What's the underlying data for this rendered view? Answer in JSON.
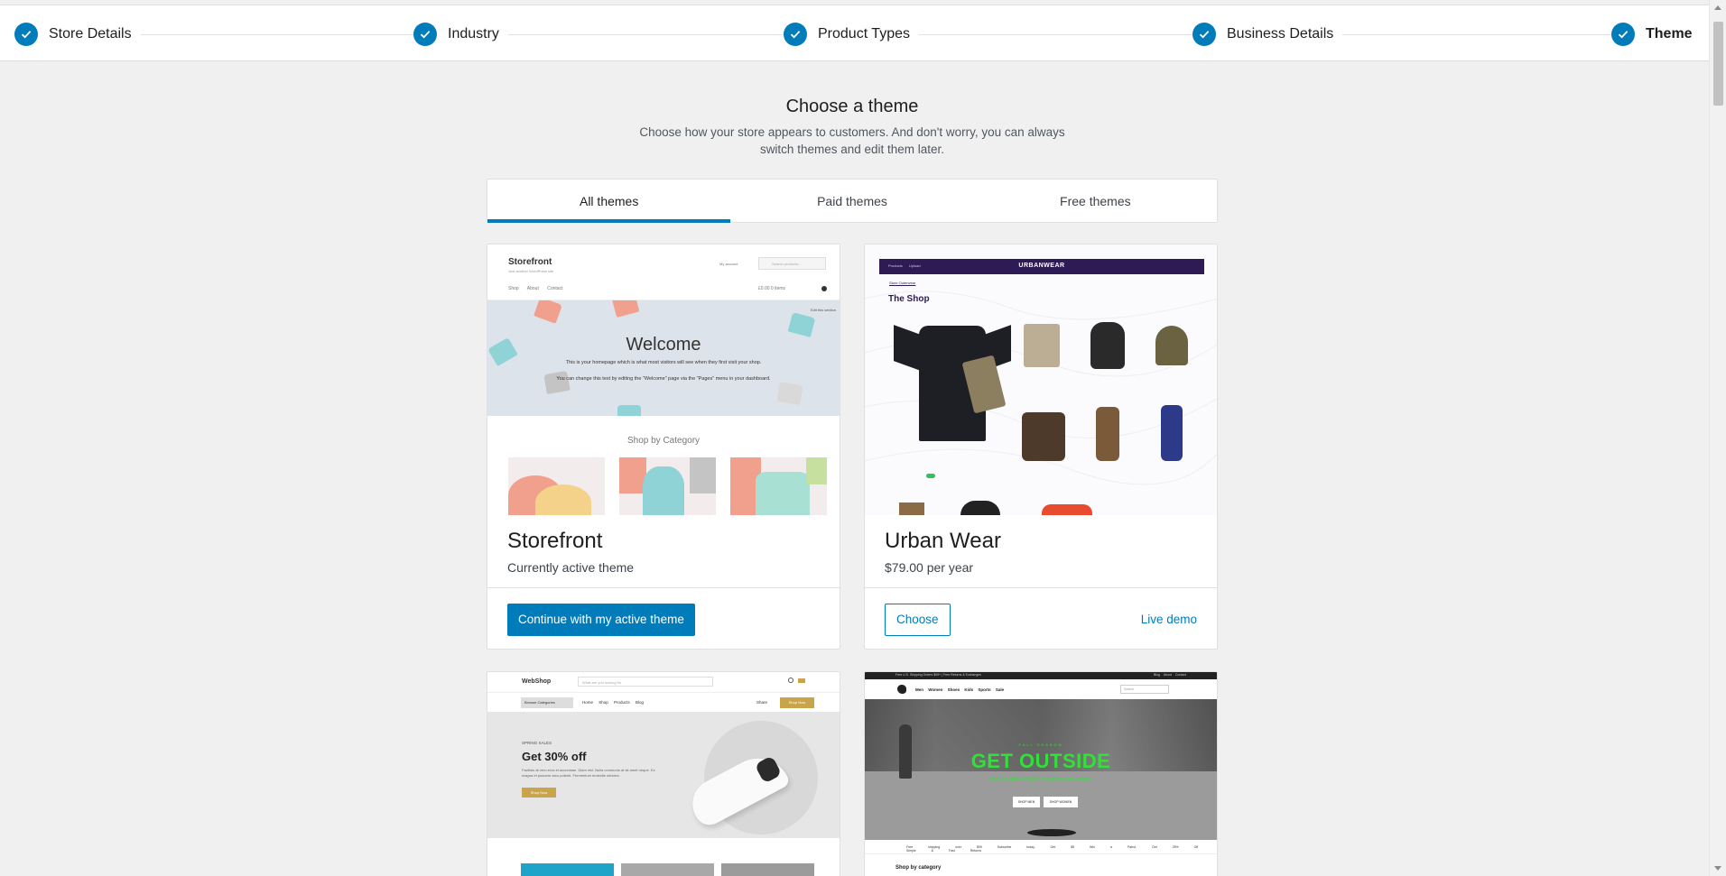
{
  "stepper": {
    "steps": [
      {
        "label": "Store Details",
        "done": true
      },
      {
        "label": "Industry",
        "done": true
      },
      {
        "label": "Product Types",
        "done": true
      },
      {
        "label": "Business Details",
        "done": true
      },
      {
        "label": "Theme",
        "done": true,
        "active": true
      }
    ]
  },
  "header": {
    "title": "Choose a theme",
    "subtitle": "Choose how your store appears to customers. And don't worry, you can always switch themes and edit them later."
  },
  "tabs": [
    {
      "label": "All themes",
      "active": true
    },
    {
      "label": "Paid themes",
      "active": false
    },
    {
      "label": "Free themes",
      "active": false
    }
  ],
  "colors": {
    "accent": "#007cba",
    "background": "#f0f0f1"
  },
  "themes": [
    {
      "name": "Storefront",
      "meta": "Currently active theme",
      "primary_action": "Continue with my active theme",
      "preview": {
        "logo": "Storefront",
        "tagline": "Just another WordPress site",
        "account": "My account",
        "search": "Search products...",
        "nav": "Shop About Contact",
        "cart": "£0.00  0 items",
        "welcome": "Welcome",
        "banner_line1": "This is your homepage which is what most visitors will see when they first visit your shop.",
        "banner_line2": "You can change this text by editing the \"Welcome\" page via the \"Pages\" menu in your dashboard.",
        "edit": "Edit this section",
        "section": "Shop by Category"
      }
    },
    {
      "name": "Urban Wear",
      "meta": "$79.00 per year",
      "primary_action": "Choose",
      "secondary_action": "Live demo",
      "preview": {
        "brand": "URBANWEAR",
        "mini_nav": "Products Upload",
        "crumb": "Store  Outerwear",
        "title": "The Shop"
      }
    },
    {
      "name": "WebShop",
      "preview": {
        "logo": "WebShop",
        "search": "What are you looking for",
        "category": "Browse Categories",
        "nav": "Home Shop Products Blog",
        "share": "Share",
        "shop_now": "Shop Now",
        "spring": "SPRING SALES",
        "headline": "Get 30% off",
        "description": "Facilisis at vero eros et accumsan. Diam nisl. Nulla commodo at sit amet neque. Ex magna et posuere arcu potenti. Fermentum molestie ultricies.",
        "cta": "Shop Now"
      }
    },
    {
      "name": "Get Outside",
      "preview": {
        "topbar": "Free U.S. Shipping Orders $99+ | Free Returns & Exchanges",
        "topbar_right": "Blog About Contact",
        "nav": "Men Women Shoes Kids Sports Sale",
        "search": "Search",
        "kicker": "FALL SEASON",
        "headline": "GET OUTSIDE",
        "sub": "Shop the latest collection of outdoor gear & apparel",
        "btn1": "SHOP MEN",
        "btn2": "SHOP WOMEN",
        "perks": "Free shipping over $99   Subscribe today, Get $5   Win a Patrol, Get 25% Off   Simple & Fast Returns",
        "section": "Shop by category"
      }
    }
  ]
}
